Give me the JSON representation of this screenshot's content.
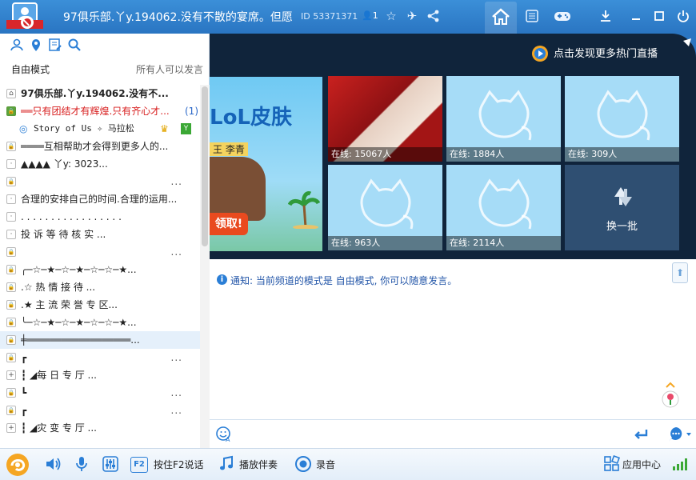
{
  "titlebar": {
    "title": "97俱乐部.丫y.194062.没有不散的宴席。但愿",
    "channel_id": "ID 53371371",
    "online": "1",
    "window_buttons": [
      "minimize-to-tray",
      "minimize",
      "maximize",
      "close"
    ]
  },
  "left_panel": {
    "mode_label": "自由模式",
    "mode_right": "所有人可以发言",
    "tree": [
      {
        "exp": "home",
        "text": "97俱乐部.丫y.194062.没有不...",
        "style": "bold"
      },
      {
        "exp": "lock-green",
        "text": "══只有团结才有辉煌.只有齐心才...",
        "count": "(1)",
        "style": "red"
      },
      {
        "exp": "user",
        "text": "Story of Us  ✧  马拉松",
        "style": "user"
      },
      {
        "exp": "lock",
        "text": "════互相帮助才会得到更多人的...",
        "style": ""
      },
      {
        "exp": "dot",
        "text": "▲▲▲▲      丫y: 3023...",
        "style": ""
      },
      {
        "exp": "lock",
        "text": "",
        "dots": "...",
        "style": ""
      },
      {
        "exp": "dot",
        "text": "合理的安排自己的时间.合理的运用...",
        "style": ""
      },
      {
        "exp": "dot",
        "text": ". . . . . . . . . . . . . . . . .",
        "style": ""
      },
      {
        "exp": "dot",
        "text": "         投 诉 等 待 核 实 ...",
        "style": ""
      },
      {
        "exp": "lock",
        "text": "",
        "dots": "...",
        "style": ""
      },
      {
        "exp": "lock",
        "text": "╭─☆─★─☆─★─☆─☆─★...",
        "style": ""
      },
      {
        "exp": "lock",
        "text": "           .☆ 热  情  接  待 ...",
        "style": ""
      },
      {
        "exp": "lock",
        "text": "         .★ 主 流 荣 誉 专 区...",
        "style": ""
      },
      {
        "exp": "lock",
        "text": "╰─☆─★─☆─★─☆─☆─★...",
        "style": ""
      },
      {
        "exp": "lock",
        "text": "╪══════════════════...",
        "style": "selected"
      },
      {
        "exp": "lock",
        "text": "┏",
        "dots": "...",
        "style": ""
      },
      {
        "exp": "plus",
        "text": "┇           ◢每  日  专  厅 ...",
        "style": ""
      },
      {
        "exp": "lock",
        "text": "┗",
        "dots": "...",
        "style": ""
      },
      {
        "exp": "lock",
        "text": "┏",
        "dots": "...",
        "style": ""
      },
      {
        "exp": "plus",
        "text": "┇           ◢灾  变  专  厅 ...",
        "style": ""
      }
    ]
  },
  "banner": {
    "promo_link": "点击发现更多热门直播",
    "ad": {
      "title": "LoL皮肤",
      "sub": "王 李青",
      "button": "领取!"
    },
    "tiles": [
      {
        "caption": "在线: 15067人",
        "kind": "photo"
      },
      {
        "caption": "在线: 1884人",
        "kind": "cat"
      },
      {
        "caption": "在线: 309人",
        "kind": "cat"
      },
      {
        "caption": "在线: 963人",
        "kind": "cat"
      },
      {
        "caption": "在线: 2114人",
        "kind": "cat"
      },
      {
        "caption": "换一批",
        "kind": "refresh"
      }
    ]
  },
  "notice": {
    "text": "通知: 当前频道的模式是 自由模式, 你可以随意发言。"
  },
  "input": {
    "placeholder": ""
  },
  "bottombar": {
    "f2_key": "F2",
    "talk_label": "按住F2说话",
    "accompany_label": "播放伴奏",
    "record_label": "录音",
    "app_center_label": "应用中心"
  },
  "colors": {
    "titlebar": "#2a75c2",
    "accent": "#2a7ed6",
    "banner_bg": "#10243b",
    "red_text": "#d71c1c"
  }
}
